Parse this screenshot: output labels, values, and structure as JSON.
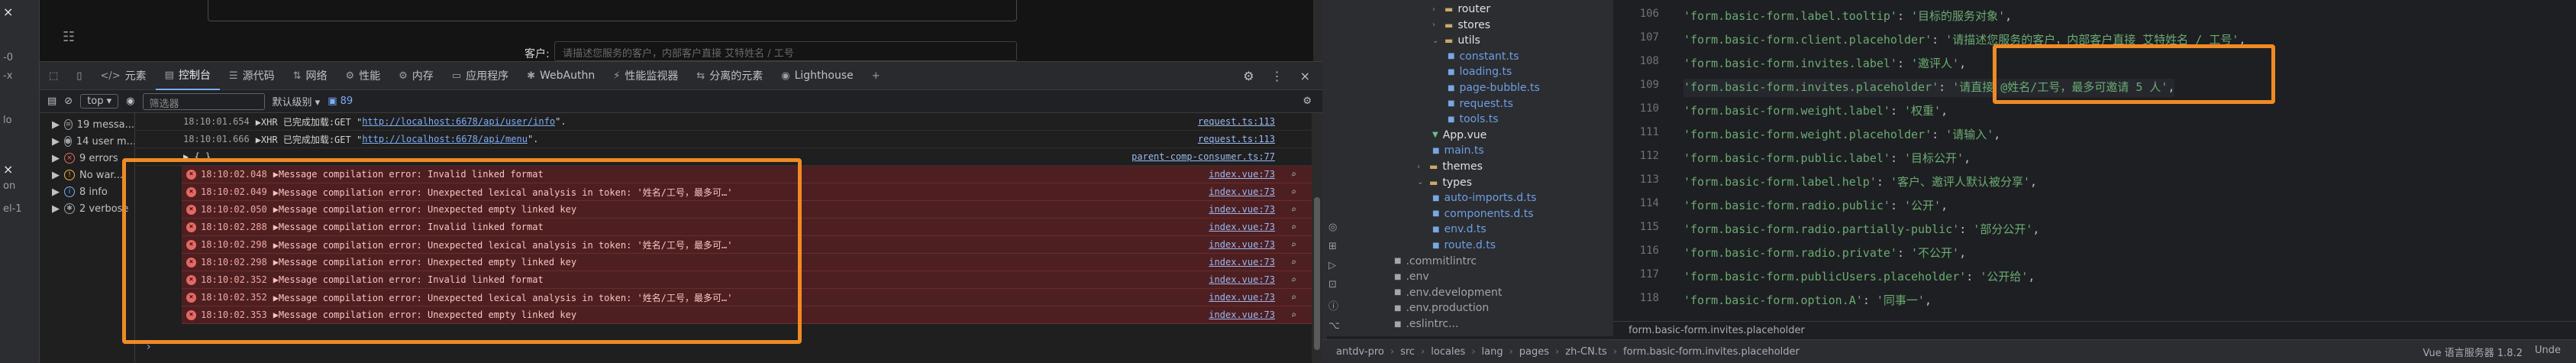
{
  "left_strip": {
    "items": [
      "-0",
      "-x",
      "lo",
      "on",
      "el-1"
    ],
    "close_glyph": "×",
    "cursor_glyph": "×"
  },
  "page": {
    "client_label": "客户:",
    "client_placeholder": "请描述您服务的客户，内部客户直接 艾特姓名 / 工号"
  },
  "devtools_tabs": [
    {
      "icon": "</>",
      "label": "元素"
    },
    {
      "icon": "▤",
      "label": "控制台"
    },
    {
      "icon": "☰",
      "label": "源代码"
    },
    {
      "icon": "⇅",
      "label": "网络"
    },
    {
      "icon": "⚙",
      "label": "性能"
    },
    {
      "icon": "⚙",
      "label": "内存"
    },
    {
      "icon": "▭",
      "label": "应用程序"
    },
    {
      "icon": "✱",
      "label": "WebAuthn"
    },
    {
      "icon": "⚡",
      "label": "性能监视器"
    },
    {
      "icon": "⇆",
      "label": "分离的元素"
    },
    {
      "icon": "◉",
      "label": "Lighthouse"
    },
    {
      "icon": "+",
      "label": ""
    }
  ],
  "devtools_right": {
    "settings": "⚙",
    "more": "⋮",
    "close": "×"
  },
  "console_bar": {
    "context": "top ▾",
    "filter_placeholder": "筛选器",
    "levels": "默认级别 ▾",
    "issues": "89"
  },
  "levels_sidebar": [
    {
      "label": "19 messa...",
      "color": "#9aa0a6",
      "glyph": "≡"
    },
    {
      "label": "14 user m...",
      "color": "#9aa0a6",
      "glyph": "●"
    },
    {
      "label": "9 errors",
      "color": "#e46962",
      "glyph": "×"
    },
    {
      "label": "No war...",
      "color": "#f2b43f",
      "glyph": "!"
    },
    {
      "label": "8 info",
      "color": "#7cacf8",
      "glyph": "i"
    },
    {
      "label": "2 verbose",
      "color": "#9aa0a6",
      "glyph": "✱"
    }
  ],
  "log_rows": [
    {
      "ts": "18:10:01.654",
      "text": "▶XHR 已完成加载:GET \"",
      "url": "http://localhost:6678/api/user/info",
      "end": "\".",
      "src": "request.ts:113",
      "err": false
    },
    {
      "ts": "18:10:01.666",
      "text": "▶XHR 已完成加载:GET \"",
      "url": "http://localhost:6678/api/menu",
      "end": "\".",
      "src": "request.ts:113",
      "err": false
    },
    {
      "ts": "",
      "text": "                                   ▶ {…}",
      "url": "",
      "end": "",
      "src": "parent-comp-consumer.ts:77",
      "err": false,
      "partial": true
    },
    {
      "ts": "18:10:02.048",
      "text": "▶Message compilation error: Invalid linked format",
      "src": "index.vue:73",
      "err": true
    },
    {
      "ts": "18:10:02.049",
      "text": "▶Message compilation error: Unexpected lexical analysis in token: '姓名/工号，最多可…'",
      "src": "index.vue:73",
      "err": true
    },
    {
      "ts": "18:10:02.050",
      "text": "▶Message compilation error: Unexpected empty linked key",
      "src": "index.vue:73",
      "err": true
    },
    {
      "ts": "18:10:02.288",
      "text": "▶Message compilation error: Invalid linked format",
      "src": "index.vue:73",
      "err": true
    },
    {
      "ts": "18:10:02.298",
      "text": "▶Message compilation error: Unexpected lexical analysis in token: '姓名/工号，最多可…'",
      "src": "index.vue:73",
      "err": true
    },
    {
      "ts": "18:10:02.298",
      "text": "▶Message compilation error: Unexpected empty linked key",
      "src": "index.vue:73",
      "err": true
    },
    {
      "ts": "18:10:02.352",
      "text": "▶Message compilation error: Invalid linked format",
      "src": "index.vue:73",
      "err": true
    },
    {
      "ts": "18:10:02.352",
      "text": "▶Message compilation error: Unexpected lexical analysis in token: '姓名/工号，最多可…'",
      "src": "index.vue:73",
      "err": true
    },
    {
      "ts": "18:10:02.353",
      "text": "▶Message compilation error: Unexpected empty linked key",
      "src": "index.vue:73",
      "err": true
    }
  ],
  "console_prompt": "›",
  "tree": [
    {
      "indent": 1,
      "kind": "folder",
      "label": "router"
    },
    {
      "indent": 1,
      "kind": "folder",
      "label": "stores"
    },
    {
      "indent": 1,
      "kind": "folder-open",
      "label": "utils"
    },
    {
      "indent": 2,
      "kind": "ts",
      "label": "constant.ts"
    },
    {
      "indent": 2,
      "kind": "ts",
      "label": "loading.ts"
    },
    {
      "indent": 2,
      "kind": "ts",
      "label": "page-bubble.ts"
    },
    {
      "indent": 2,
      "kind": "ts",
      "label": "request.ts"
    },
    {
      "indent": 2,
      "kind": "ts",
      "label": "tools.ts"
    },
    {
      "indent": 1,
      "kind": "vue",
      "label": "App.vue"
    },
    {
      "indent": 1,
      "kind": "ts",
      "label": "main.ts"
    },
    {
      "indent": 0,
      "kind": "folder",
      "label": "themes"
    },
    {
      "indent": 0,
      "kind": "folder-open",
      "label": "types"
    },
    {
      "indent": 1,
      "kind": "ts",
      "label": "auto-imports.d.ts"
    },
    {
      "indent": 1,
      "kind": "ts",
      "label": "components.d.ts"
    },
    {
      "indent": 1,
      "kind": "ts",
      "label": "env.d.ts"
    },
    {
      "indent": 1,
      "kind": "ts",
      "label": "route.d.ts"
    },
    {
      "indent": -1,
      "kind": "cfg",
      "label": ".commitlintrc"
    },
    {
      "indent": -1,
      "kind": "cfg",
      "label": ".env"
    },
    {
      "indent": -1,
      "kind": "cfg",
      "label": ".env.development"
    },
    {
      "indent": -1,
      "kind": "cfg",
      "label": ".env.production"
    },
    {
      "indent": -1,
      "kind": "cfg",
      "label": ".eslintrc..."
    }
  ],
  "code_lines": [
    {
      "n": "106",
      "key": "'form.basic-form.label.tooltip'",
      "val": "'目标的服务对象'"
    },
    {
      "n": "107",
      "key": "'form.basic-form.client.placeholder'",
      "val": "'请描述您服务的客户，内部客户直接 艾特姓名 / 工号'"
    },
    {
      "n": "108",
      "key": "'form.basic-form.invites.label'",
      "val": "'邀评人'"
    },
    {
      "n": "109",
      "key": "'form.basic-form.invites.placeholder'",
      "val": "'请直接 @姓名/工号，最多可邀请 5 人'"
    },
    {
      "n": "110",
      "key": "'form.basic-form.weight.label'",
      "val": "'权重'"
    },
    {
      "n": "111",
      "key": "'form.basic-form.weight.placeholder'",
      "val": "'请输入'"
    },
    {
      "n": "112",
      "key": "'form.basic-form.public.label'",
      "val": "'目标公开'"
    },
    {
      "n": "113",
      "key": "'form.basic-form.label.help'",
      "val": "'客户、邀评人默认被分享'"
    },
    {
      "n": "114",
      "key": "'form.basic-form.radio.public'",
      "val": "'公开'"
    },
    {
      "n": "115",
      "key": "'form.basic-form.radio.partially-public'",
      "val": "'部分公开'"
    },
    {
      "n": "116",
      "key": "'form.basic-form.radio.private'",
      "val": "'不公开'"
    },
    {
      "n": "117",
      "key": "'form.basic-form.publicUsers.placeholder'",
      "val": "'公开给'"
    },
    {
      "n": "118",
      "key": "'form.basic-form.option.A'",
      "val": "'同事一'"
    }
  ],
  "editor_breadcrumb": "form.basic-form.invites.placeholder",
  "status_bar": {
    "path": [
      "antdv-pro",
      "src",
      "locales",
      "lang",
      "pages",
      "zh-CN.ts",
      "form.basic-form.invites.placeholder"
    ],
    "right": [
      "Vue 语言服务器 1.8.2",
      "Unde"
    ]
  },
  "colors": {
    "highlight": "#f08a24",
    "error_bg": "#4e1f21",
    "string": "#6aab73"
  }
}
